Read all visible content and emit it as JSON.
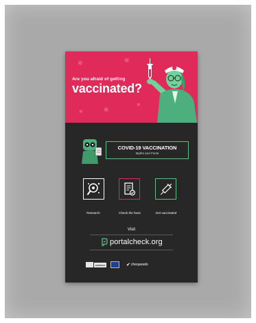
{
  "hero": {
    "question_small": "Are you afraid of getting",
    "question_big": "vaccinated?"
  },
  "title": {
    "main": "COVID-19 VACCINATION",
    "sub": "Myths and Facts"
  },
  "tiles": [
    {
      "label": "Research",
      "icon": "magnifier-virus-icon"
    },
    {
      "label": "Check the facts",
      "icon": "document-check-icon"
    },
    {
      "label": "Get vaccinated",
      "icon": "syringe-icon"
    }
  ],
  "visit": {
    "label": "Visit",
    "url": "portalcheck.org"
  },
  "footer": {
    "unesco": "unesco",
    "checkbox": "chequeado"
  },
  "colors": {
    "pink": "#e02a5a",
    "green": "#5fbf8b",
    "dark": "#272727"
  }
}
